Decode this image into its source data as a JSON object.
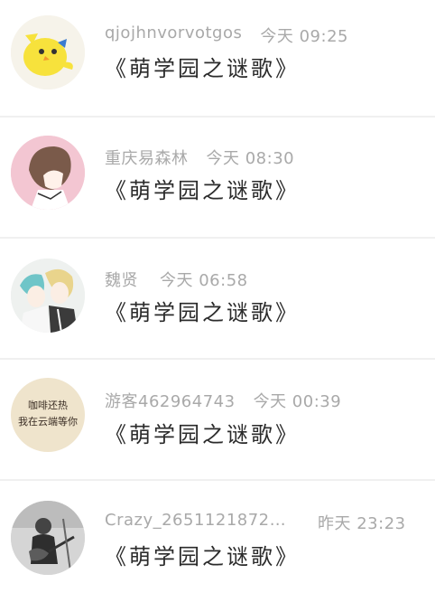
{
  "messages": [
    {
      "name": "qjojhnvorvotgos",
      "time": "今天 09:25",
      "title": "《萌学园之谜歌》",
      "avatar": "yellow-chick-avatar"
    },
    {
      "name": "重庆易森林",
      "time": "今天 08:30",
      "title": "《萌学园之谜歌》",
      "avatar": "anime-profile-avatar"
    },
    {
      "name": "魏贤",
      "time": "今天 06:58",
      "title": "《萌学园之谜歌》",
      "avatar": "anime-duo-avatar"
    },
    {
      "name": "游客462964743",
      "time": "今天 00:39",
      "title": "《萌学园之谜歌》",
      "avatar": "handwriting-avatar",
      "avatar_text_line1": "咖啡还热",
      "avatar_text_line2": "我在云端等你"
    },
    {
      "name": "Crazy_2651121872…",
      "time": "昨天 23:23",
      "title": "《萌学园之谜歌》",
      "avatar": "guitarist-avatar"
    }
  ]
}
